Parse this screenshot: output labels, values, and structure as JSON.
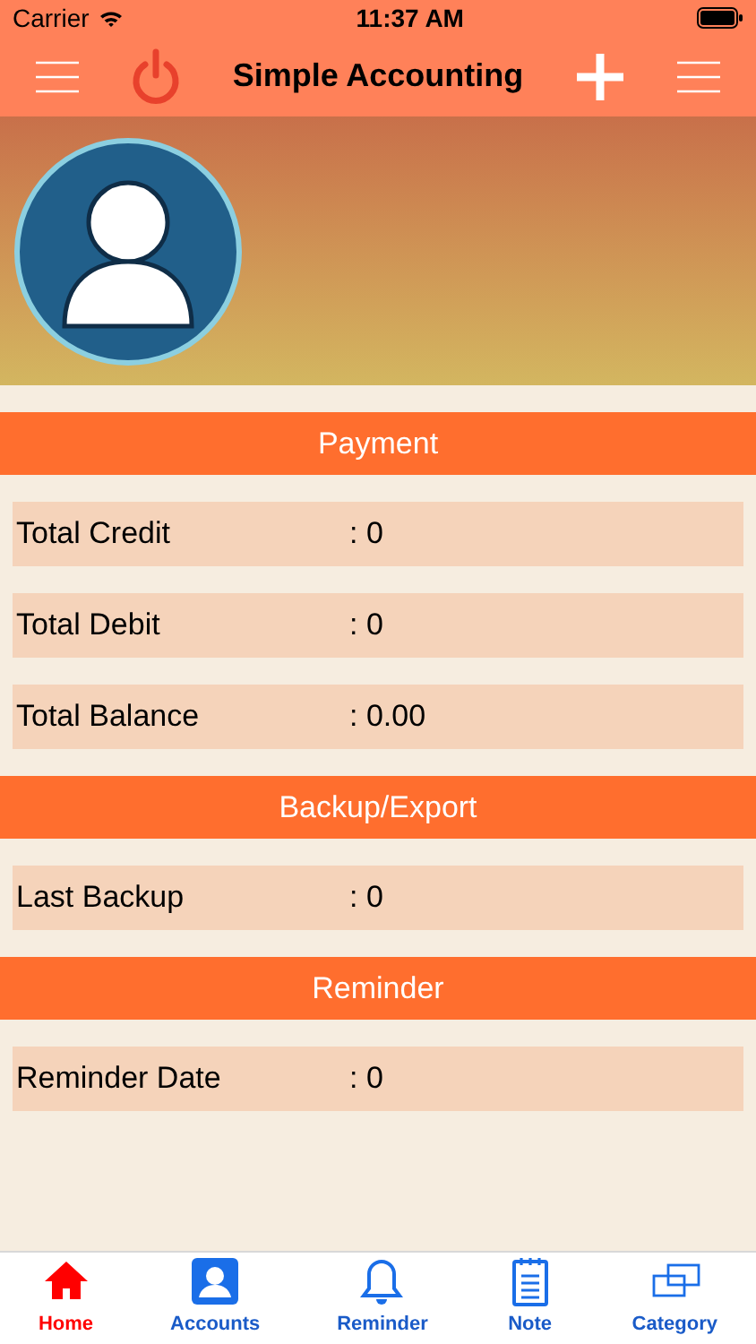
{
  "status_bar": {
    "carrier": "Carrier",
    "time": "11:37 AM"
  },
  "nav": {
    "title": "Simple Accounting"
  },
  "sections": [
    {
      "title": "Payment",
      "rows": [
        {
          "label": "Total Credit",
          "value": ": 0"
        },
        {
          "label": "Total Debit",
          "value": ": 0"
        },
        {
          "label": "Total Balance",
          "value": ": 0.00"
        }
      ]
    },
    {
      "title": "Backup/Export",
      "rows": [
        {
          "label": "Last Backup",
          "value": ": 0"
        }
      ]
    },
    {
      "title": "Reminder",
      "rows": [
        {
          "label": "Reminder Date",
          "value": ": 0"
        }
      ]
    }
  ],
  "tab_bar": [
    {
      "kind": "home",
      "label": "Home",
      "selected": true
    },
    {
      "kind": "accounts",
      "label": "Accounts",
      "selected": false
    },
    {
      "kind": "reminder",
      "label": "Reminder",
      "selected": false
    },
    {
      "kind": "note",
      "label": "Note",
      "selected": false
    },
    {
      "kind": "category",
      "label": "Category",
      "selected": false
    }
  ]
}
